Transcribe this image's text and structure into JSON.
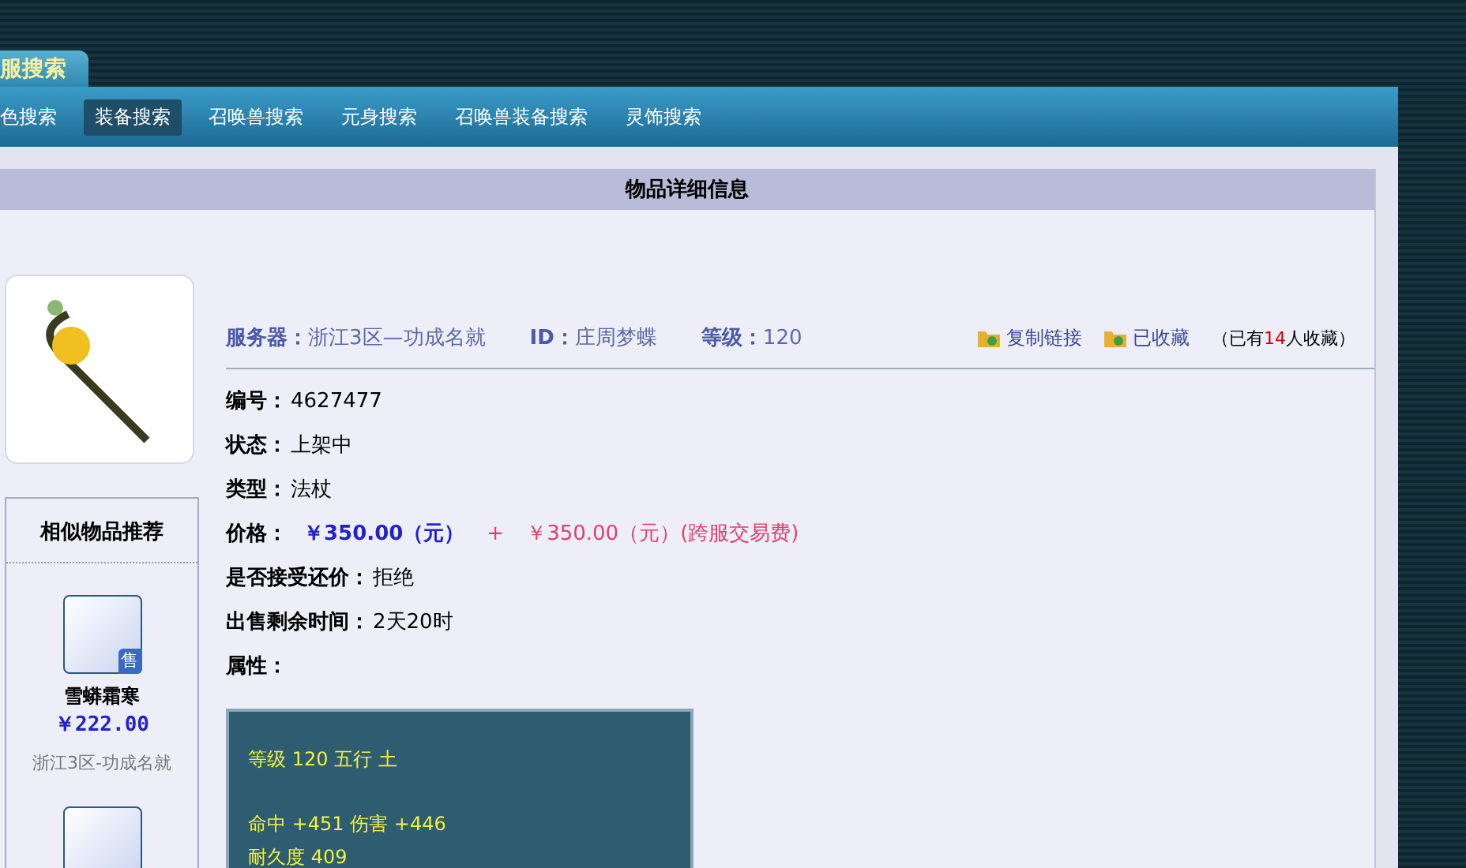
{
  "header_tab": {
    "label": "服搜索"
  },
  "nav": [
    {
      "label": "色搜索",
      "selected": false
    },
    {
      "label": "装备搜索",
      "selected": true
    },
    {
      "label": "召唤兽搜索",
      "selected": false
    },
    {
      "label": "元身搜索",
      "selected": false
    },
    {
      "label": "召唤兽装备搜索",
      "selected": false
    },
    {
      "label": "灵饰搜索",
      "selected": false
    }
  ],
  "panel_title": "物品详细信息",
  "info_bar": {
    "server_label": "服务器：",
    "server": "浙江3区—功成名就",
    "id_label": "ID：",
    "id": "庄周梦蝶",
    "level_label": "等级：",
    "level": "120",
    "copy_link": "复制链接",
    "favorited": "已收藏",
    "favorite_prefix": "（已有",
    "favorite_count": "14",
    "favorite_suffix": "人收藏）"
  },
  "fields": [
    {
      "kind": "text",
      "label": "编号：",
      "value": "4627477"
    },
    {
      "kind": "text",
      "label": "状态：",
      "value": "上架中"
    },
    {
      "kind": "text",
      "label": "类型：",
      "value": "法杖"
    },
    {
      "kind": "price",
      "label": "价格：",
      "price": "￥350.00（元）",
      "plus": "+",
      "fee": "￥350.00（元）(跨服交易费)"
    },
    {
      "kind": "text",
      "label": "是否接受还价：",
      "value": "拒绝"
    },
    {
      "kind": "text",
      "label": "出售剩余时间：",
      "value": "2天20时"
    },
    {
      "kind": "heading",
      "label": "属性："
    }
  ],
  "attributes": [
    [
      "等级 120 五行 土"
    ],
    [
      "命中 +451 伤害 +446",
      "耐久度 409"
    ]
  ],
  "similar": {
    "title": "相似物品推荐",
    "items": [
      {
        "kind": "full",
        "badge": "售",
        "name": "雪蟒霜寒",
        "price": "￥222.00",
        "server": "浙江3区-功成名就"
      },
      {
        "kind": "image"
      }
    ]
  }
}
